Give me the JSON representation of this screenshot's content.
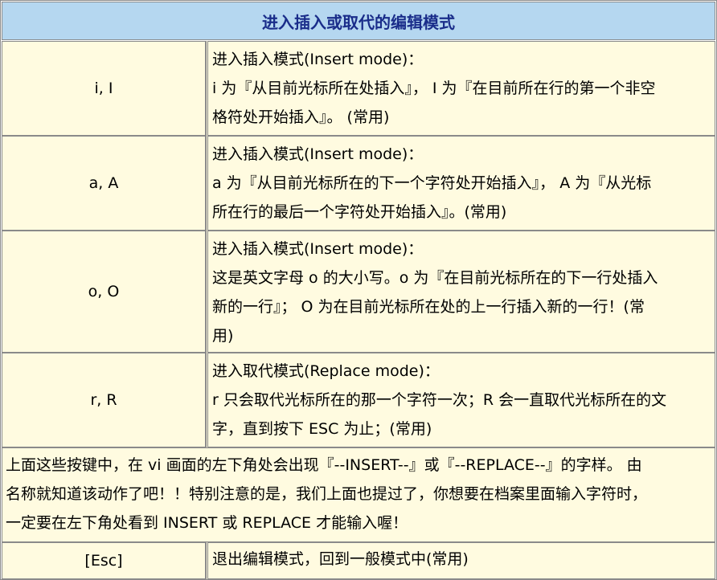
{
  "table": {
    "title": "进入插入或取代的编辑模式",
    "rows": [
      {
        "key": "i, I",
        "lines": [
          "进入插入模式(Insert mode)：",
          "i 为『从目前光标所在处插入』， I 为『在目前所在行的第一个非空",
          "格符处开始插入』。 (常用)"
        ]
      },
      {
        "key": "a, A",
        "lines": [
          "进入插入模式(Insert mode)：",
          "a 为『从目前光标所在的下一个字符处开始插入』， A 为『从光标",
          "所在行的最后一个字符处开始插入』。(常用)"
        ]
      },
      {
        "key": "o, O",
        "lines": [
          "进入插入模式(Insert mode)：",
          "这是英文字母 o 的大小写。o 为『在目前光标所在的下一行处插入",
          "新的一行』； O 为在目前光标所在处的上一行插入新的一行！(常",
          "用)"
        ]
      },
      {
        "key": "r, R",
        "lines": [
          "进入取代模式(Replace mode)：",
          "r 只会取代光标所在的那一个字符一次；R 会一直取代光标所在的文",
          "字，直到按下 ESC 为止；(常用)"
        ]
      }
    ],
    "note_lines": [
      "上面这些按键中，在 vi 画面的左下角处会出现『--INSERT--』或『--REPLACE--』的字样。 由",
      "名称就知道该动作了吧！！特别注意的是，我们上面也提过了，你想要在档案里面输入字符时，",
      "一定要在左下角处看到 INSERT 或 REPLACE 才能输入喔！"
    ],
    "esc_row": {
      "key": "[Esc]",
      "lines": [
        "退出编辑模式，回到一般模式中(常用)"
      ]
    }
  }
}
